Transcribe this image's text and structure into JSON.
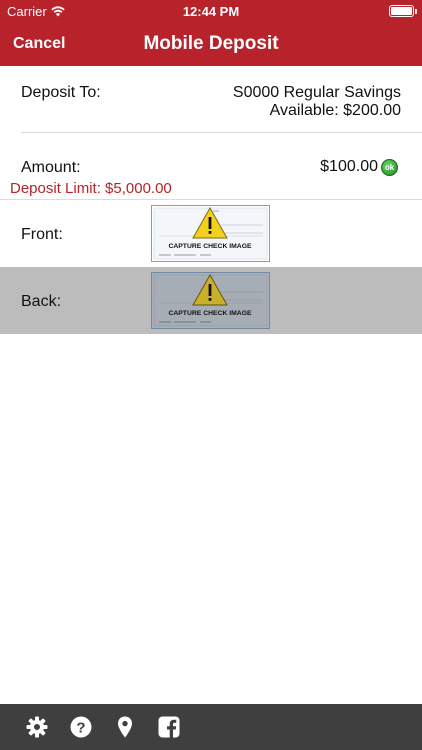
{
  "status_bar": {
    "carrier": "Carrier",
    "time": "12:44 PM"
  },
  "nav": {
    "cancel_label": "Cancel",
    "title": "Mobile Deposit"
  },
  "deposit_to": {
    "label": "Deposit To:",
    "account": "S0000 Regular Savings",
    "available": "Available: $200.00"
  },
  "amount": {
    "label": "Amount:",
    "value": "$100.00",
    "ok_label": "ok",
    "limit": "Deposit Limit: $5,000.00"
  },
  "front": {
    "label": "Front:",
    "image_caption": "CAPTURE CHECK IMAGE"
  },
  "back": {
    "label": "Back:",
    "image_caption": "CAPTURE CHECK IMAGE"
  },
  "toolbar": {
    "icons": [
      "gear-icon",
      "help-icon",
      "location-pin-icon",
      "facebook-icon"
    ]
  },
  "colors": {
    "brand_red": "#b8222a",
    "toolbar": "#3f3f3f",
    "selected_row": "#bcbcbc",
    "ok_green": "#1d8a1d",
    "warning_yellow": "#f2d11c"
  }
}
